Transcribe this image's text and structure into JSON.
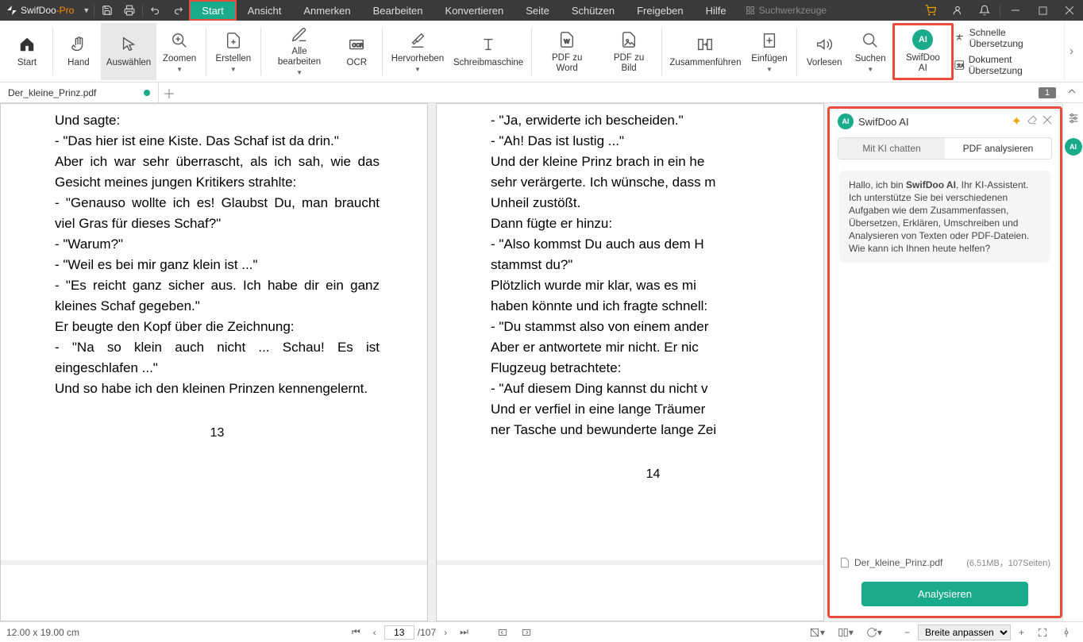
{
  "titlebar": {
    "app_name": "SwifDoo",
    "app_suffix": "-Pro"
  },
  "menu": {
    "items": [
      "Start",
      "Ansicht",
      "Anmerken",
      "Bearbeiten",
      "Konvertieren",
      "Seite",
      "Schützen",
      "Freigeben",
      "Hilfe"
    ],
    "search_placeholder": "Suchwerkzeuge"
  },
  "ribbon": {
    "start": "Start",
    "hand": "Hand",
    "select": "Auswählen",
    "zoom": "Zoomen",
    "create": "Erstellen",
    "edit_all": "Alle bearbeiten",
    "ocr": "OCR",
    "highlight": "Hervorheben",
    "typewriter": "Schreibmaschine",
    "pdf_word": "PDF zu Word",
    "pdf_bild": "PDF zu Bild",
    "merge": "Zusammenführen",
    "insert": "Einfügen",
    "read": "Vorlesen",
    "search": "Suchen",
    "ai": "SwifDoo AI",
    "quick_translate": "Schnelle Übersetzung",
    "doc_translate": "Dokument Übersetzung"
  },
  "tabs": {
    "file_name": "Der_kleine_Prinz.pdf",
    "page_indicator": "1"
  },
  "page_left": {
    "text": "Und sagte:\n- \"Das hier ist eine Kiste. Das Schaf ist da drin.\"\nAber ich war sehr überrascht, als ich sah, wie das Gesicht meines jungen Kritikers strahlte:\n- \"Genauso wollte ich es! Glaubst Du, man braucht viel Gras für dieses Schaf?\"\n- \"Warum?\"\n- \"Weil es bei mir ganz klein ist ...\"\n- \"Es reicht ganz sicher aus. Ich habe dir ein ganz kleines Schaf gegeben.\"\nEr beugte den Kopf über die Zeichnung:\n- \"Na so klein auch nicht ... Schau! Es ist eingeschlafen ...\"\nUnd so habe ich den kleinen Prinzen kennengelernt.",
    "num": "13"
  },
  "page_right": {
    "text": "- \"Ja, erwiderte ich bescheiden.\"\n- \"Ah! Das ist lustig ...\"\nUnd der kleine Prinz brach in ein he\nsehr verärgerte. Ich wünsche, dass m\nUnheil zustößt.\nDann fügte er hinzu:\n- \"Also kommst Du auch aus dem H\nstammst du?\"\nPlötzlich wurde mir klar, was es mi\nhaben könnte und ich fragte schnell:\n- \"Du stammst also von einem ander\nAber er antwortete mir nicht. Er nic\nFlugzeug betrachtete:\n- \"Auf diesem Ding kannst du nicht v\nUnd er verfiel in eine lange Träumer\nner Tasche und bewunderte lange Zei",
    "num": "14"
  },
  "ai_panel": {
    "title": "SwifDoo AI",
    "tab_chat": "Mit KI chatten",
    "tab_analyze": "PDF analysieren",
    "msg_prefix": "Hallo, ich bin ",
    "msg_bold": "SwifDoo AI",
    "msg_suffix": ", Ihr KI-Assistent. Ich unterstütze Sie bei verschiedenen Aufgaben wie dem Zusammenfassen, Übersetzen, Erklären, Umschreiben und Analysieren von Texten oder PDF-Dateien. Wie kann ich Ihnen heute helfen?",
    "file_name": "Der_kleine_Prinz.pdf",
    "file_meta": "(6.51MB，107Seiten)",
    "analyze_btn": "Analysieren"
  },
  "statusbar": {
    "dims": "12.00 x 19.00 cm",
    "current_page": "13",
    "total_pages": "/107",
    "fit": "Breite anpassen"
  }
}
